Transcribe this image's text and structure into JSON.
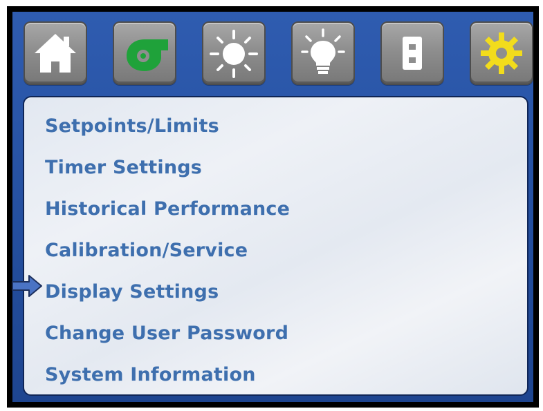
{
  "toolbar": {
    "buttons": [
      {
        "name": "home",
        "icon": "home-icon"
      },
      {
        "name": "fan",
        "icon": "blower-fan-icon",
        "accent": "#1fa23a"
      },
      {
        "name": "sun",
        "icon": "sun-icon"
      },
      {
        "name": "light",
        "icon": "light-bulb-icon"
      },
      {
        "name": "outlet",
        "icon": "outlet-icon"
      },
      {
        "name": "settings",
        "icon": "gear-icon",
        "accent": "#f2dc1c",
        "active": true
      }
    ]
  },
  "menu": {
    "items": [
      {
        "label": "Setpoints/Limits"
      },
      {
        "label": "Timer Settings"
      },
      {
        "label": "Historical Performance"
      },
      {
        "label": "Calibration/Service"
      },
      {
        "label": "Display Settings",
        "selected": true
      },
      {
        "label": "Change User Password"
      },
      {
        "label": "System Information"
      }
    ]
  },
  "colors": {
    "screen_blue": "#2a55a6",
    "menu_text": "#3e6fae",
    "selector_arrow": "#4a73c4"
  }
}
